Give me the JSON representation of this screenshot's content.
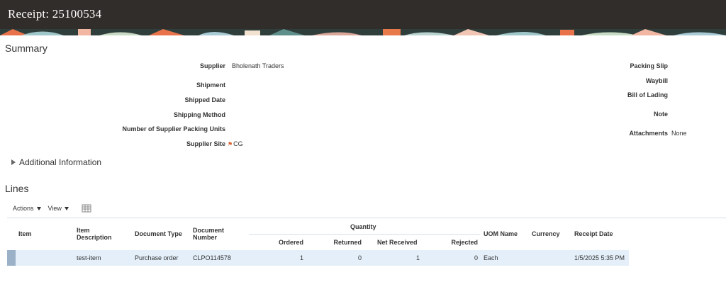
{
  "header": {
    "title": "Receipt: 25100534"
  },
  "summary": {
    "heading": "Summary",
    "left": [
      {
        "label": "Supplier",
        "value": "Bholenath Traders"
      },
      {
        "label": "Shipment",
        "value": ""
      },
      {
        "label": "Shipped Date",
        "value": ""
      },
      {
        "label": "Shipping Method",
        "value": ""
      },
      {
        "label": "Number of Supplier Packing Units",
        "value": ""
      },
      {
        "label": "Supplier Site",
        "value": "CG"
      }
    ],
    "right": [
      {
        "label": "Packing Slip",
        "value": ""
      },
      {
        "label": "Waybill",
        "value": ""
      },
      {
        "label": "Bill of Lading",
        "value": ""
      },
      {
        "label": "Note",
        "value": ""
      },
      {
        "label": "Attachments",
        "value": "None"
      }
    ],
    "supplier_site_icon": "flag-icon"
  },
  "additional_info": {
    "label": "Additional Information"
  },
  "lines": {
    "heading": "Lines",
    "toolbar": {
      "actions_label": "Actions",
      "view_label": "View",
      "icon": "freeze-columns-icon"
    },
    "columns": {
      "item": "Item",
      "item_description": "Item Description",
      "document_type": "Document Type",
      "document_number": "Document Number",
      "quantity": "Quantity",
      "ordered": "Ordered",
      "returned": "Returned",
      "net_received": "Net Received",
      "rejected": "Rejected",
      "uom_name": "UOM Name",
      "currency": "Currency",
      "receipt_date": "Receipt Date"
    },
    "rows": [
      {
        "item": "",
        "item_description": "test-item",
        "document_type": "Purchase order",
        "document_number": "CLPO114578",
        "ordered": "1",
        "returned": "0",
        "net_received": "1",
        "rejected": "0",
        "uom_name": "Each",
        "currency": "",
        "receipt_date": "1/5/2025 5:35 PM"
      }
    ]
  },
  "colors": {
    "header_bg": "#312d2a",
    "row_selected": "#e4effa",
    "selector": "#9ab1c7"
  }
}
